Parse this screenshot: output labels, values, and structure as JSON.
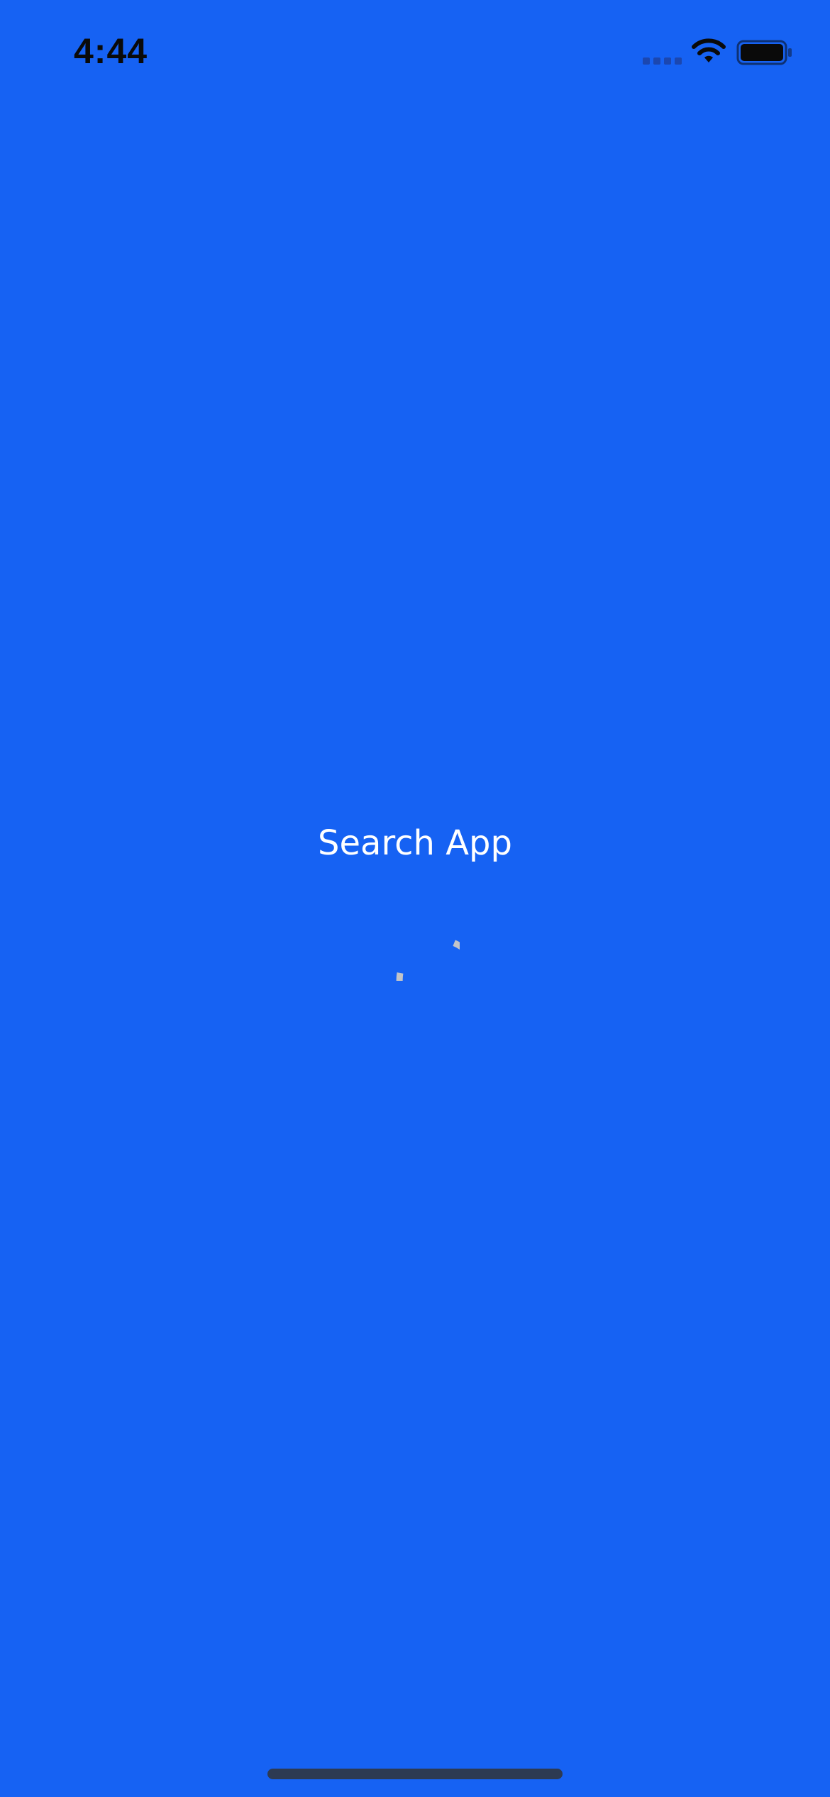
{
  "colors": {
    "background": "#1662f3",
    "status_text": "#0a0a0a",
    "title_text": "#ffffff",
    "spinner": "#c2c4c8",
    "home_indicator": "#2d3a52",
    "signal_dim": "#1b47b0"
  },
  "status_bar": {
    "time": "4:44",
    "icons": [
      "cellular-signal-icon",
      "wifi-icon",
      "battery-icon"
    ]
  },
  "splash": {
    "title": "Search App",
    "loading_indicator": "spinner-icon"
  }
}
